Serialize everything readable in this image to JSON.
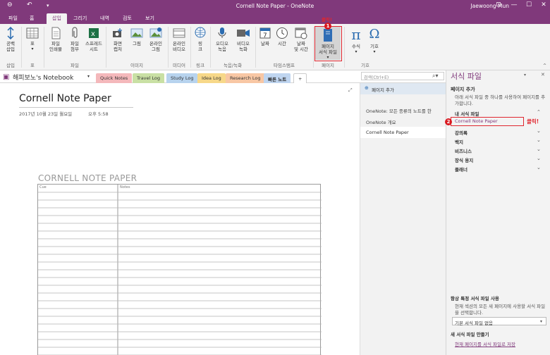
{
  "window": {
    "title": "Cornell Note Paper  -  OneNote",
    "user": "Jaewoong Mun"
  },
  "tabs": [
    "파일",
    "홈",
    "삽입",
    "그리기",
    "내역",
    "검토",
    "보기"
  ],
  "ribbon": {
    "buttons": {
      "blank": "공백\n삽입",
      "table": "표",
      "printout": "파일\n인쇄물",
      "attach": "파일\n첨부",
      "spreadsheet": "스프레드\n시트",
      "screenclip": "화면\n캡처",
      "picture": "그림",
      "online_picture": "온라인\n그림",
      "online_video": "온라인\n비디오",
      "link": "링\n크",
      "audio": "오디오\n녹음",
      "video": "비디오\n녹화",
      "date": "날짜",
      "time": "시간",
      "datetime": "날짜\n및 시간",
      "page_template": "페이지\n서식 파일",
      "equation": "수식",
      "symbol": "기호"
    },
    "groups": {
      "insert": "삽입",
      "table": "표",
      "file": "파일",
      "image": "이미지",
      "media": "미디어",
      "link": "링크",
      "record": "녹음/녹화",
      "timestamp": "타임스탬프",
      "page": "페이지",
      "symbol": "기호"
    },
    "click_label": "클릭!",
    "badge1": "1"
  },
  "notebook": {
    "name": "해피보노's Notebook",
    "sections": [
      "Quick Notes",
      "Travel Log",
      "Study Log",
      "Idea Log",
      "Research Log",
      "빠른 노트",
      "+"
    ],
    "search_placeholder": "검색(Ctrl+E)"
  },
  "page": {
    "title": "Cornell Note Paper",
    "date": "2017년 10월 23일 월요일",
    "time": "오후 5:58",
    "template_heading": "CORNELL NOTE PAPER",
    "cue_label": "Cue",
    "notes_label": "Notes"
  },
  "pagelist": {
    "add_page": "페이지 추가",
    "pages": [
      "OneNote: 모든 종류의 노트를 한",
      "OneNote 개요",
      "Cornell Note Paper"
    ]
  },
  "pane": {
    "title": "서식 파일",
    "add_page_heading": "페이지 추가",
    "add_page_desc": "아래 서식 파일 중 하나를 사용하여 페이지를 추가합니다.",
    "my_templates": "내 서식 파일",
    "selected_template": "Cornell Note Paper",
    "click_label": "클릭!",
    "badge2": "2",
    "categories": [
      "강의록",
      "백지",
      "비즈니스",
      "장식 용지",
      "플래너"
    ],
    "always_use_heading": "항상 특정 서식 파일 사용",
    "always_use_desc": "현재 섹션의 모든 새 페이지에 사용할 서식 파일을 선택합니다.",
    "dropdown_value": "기본 서식 파일 없음",
    "create_heading": "새 서식 파일 만들기",
    "save_link": "현재 페이지를 서식 파일로 저장"
  },
  "colors": {
    "accent": "#80397b",
    "highlight": "#e0262f",
    "link": "#80397b"
  }
}
